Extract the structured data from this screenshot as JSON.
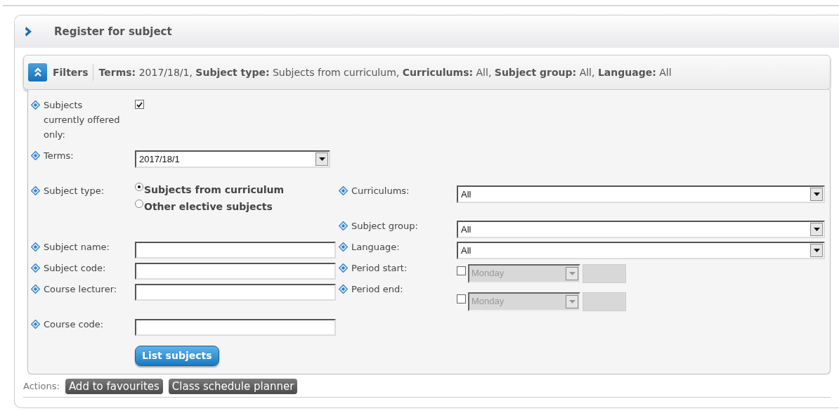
{
  "title": "Register for subject",
  "filters": {
    "label": "Filters",
    "summary": "**Terms:** 2017/18/1, **Subject type:** Subjects from curriculum, **Curriculums:** All, **Subject group:** All, **Language:** All"
  },
  "left_fields": [
    {
      "kind": "checkbox",
      "label": "Subjects currently offered only:",
      "checked": true
    },
    {
      "kind": "select",
      "label": "Terms:",
      "value": "2017/18/1"
    },
    {
      "kind": "radio",
      "label": "Subject type:",
      "options": [
        {
          "label": "Subjects from curriculum",
          "selected": true
        },
        {
          "label": "Other elective subjects",
          "selected": false
        }
      ]
    },
    {
      "kind": "text",
      "label": "Subject name:"
    },
    {
      "kind": "text",
      "label": "Subject code:"
    },
    {
      "kind": "text",
      "label": "Course lecturer:"
    },
    {
      "kind": "text",
      "label": "Course code:"
    }
  ],
  "right_fields": [
    {
      "kind": "select",
      "label": "Curriculums:",
      "value": "All"
    },
    {
      "kind": "select",
      "label": "Subject group:",
      "value": "All"
    },
    {
      "kind": "select",
      "label": "Language:",
      "value": "All"
    },
    {
      "kind": "period",
      "label": "Period start:",
      "checked": false,
      "day": "Monday",
      "disabled": true
    },
    {
      "kind": "period",
      "label": "Period end:",
      "checked": false,
      "day": "Monday",
      "disabled": true
    }
  ],
  "submit": "List subjects",
  "actions": {
    "label": "Actions:",
    "buttons": [
      "Add to favourites",
      "Class schedule planner"
    ]
  }
}
